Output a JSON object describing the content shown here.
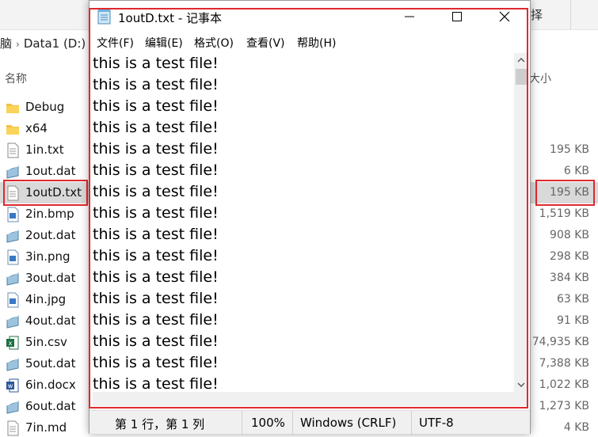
{
  "explorer": {
    "ribbon_partial": "择",
    "address": [
      "脑",
      "Data1 (D:)"
    ],
    "columns": {
      "name": "名称",
      "size": "大小"
    },
    "files": [
      {
        "name": "Debug",
        "size": "",
        "icon": "folder-icon"
      },
      {
        "name": "x64",
        "size": "",
        "icon": "folder-icon"
      },
      {
        "name": "1in.txt",
        "size": "195 KB",
        "icon": "text-file-icon"
      },
      {
        "name": "1out.dat",
        "size": "6 KB",
        "icon": "dat-file-icon"
      },
      {
        "name": "1outD.txt",
        "size": "195 KB",
        "icon": "text-file-icon",
        "selected": true
      },
      {
        "name": "2in.bmp",
        "size": "1,519 KB",
        "icon": "image-file-icon"
      },
      {
        "name": "2out.dat",
        "size": "908 KB",
        "icon": "dat-file-icon"
      },
      {
        "name": "3in.png",
        "size": "298 KB",
        "icon": "image-file-icon"
      },
      {
        "name": "3out.dat",
        "size": "384 KB",
        "icon": "dat-file-icon"
      },
      {
        "name": "4in.jpg",
        "size": "63 KB",
        "icon": "image-file-icon"
      },
      {
        "name": "4out.dat",
        "size": "91 KB",
        "icon": "dat-file-icon"
      },
      {
        "name": "5in.csv",
        "size": "74,935 KB",
        "icon": "excel-file-icon"
      },
      {
        "name": "5out.dat",
        "size": "7,388 KB",
        "icon": "dat-file-icon"
      },
      {
        "name": "6in.docx",
        "size": "1,022 KB",
        "icon": "word-file-icon"
      },
      {
        "name": "6out.dat",
        "size": "1,273 KB",
        "icon": "dat-file-icon"
      },
      {
        "name": "7in.md",
        "size": "4 KB",
        "icon": "text-file-icon"
      }
    ]
  },
  "notepad": {
    "title": "1outD.txt - 记事本",
    "menu": [
      "文件(F)",
      "编辑(E)",
      "格式(O)",
      "查看(V)",
      "帮助(H)"
    ],
    "lines": [
      "this is a test file!",
      "this is a test file!",
      "this is a test file!",
      "this is a test file!",
      "this is a test file!",
      "this is a test file!",
      "this is a test file!",
      "this is a test file!",
      "this is a test file!",
      "this is a test file!",
      "this is a test file!",
      "this is a test file!",
      "this is a test file!",
      "this is a test file!",
      "this is a test file!",
      "this is a test file!"
    ],
    "status": {
      "position": "第 1 行，第 1 列",
      "zoom": "100%",
      "line_ending": "Windows (CRLF)",
      "encoding": "UTF-8"
    }
  },
  "colors": {
    "highlight_box": "#e0282e",
    "selected_row": "#d9d9d9"
  }
}
